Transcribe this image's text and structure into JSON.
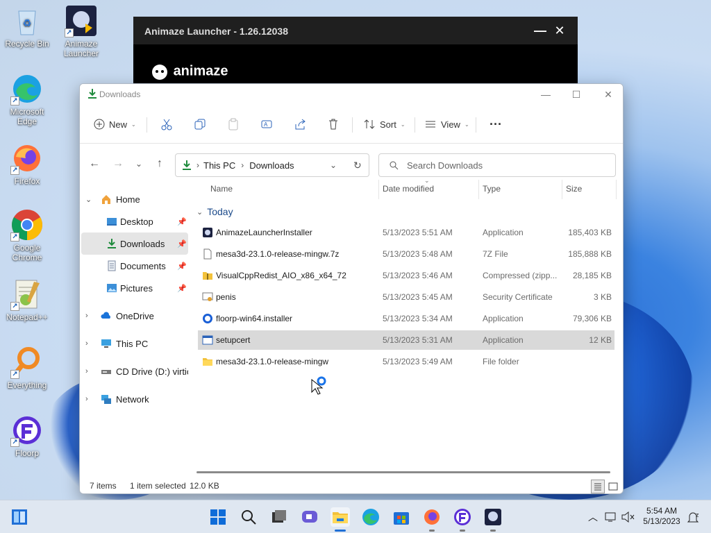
{
  "desktop": {
    "icons": [
      {
        "label": "Recycle Bin",
        "icon": "recycle-bin-icon"
      },
      {
        "label": "Animaze Launcher",
        "icon": "animaze-icon"
      },
      {
        "label": "Microsoft Edge",
        "icon": "edge-icon"
      },
      {
        "label": "Firefox",
        "icon": "firefox-icon"
      },
      {
        "label": "Google Chrome",
        "icon": "chrome-icon"
      },
      {
        "label": "Notepad++",
        "icon": "notepadpp-icon"
      },
      {
        "label": "Everything",
        "icon": "everything-icon"
      },
      {
        "label": "Floorp",
        "icon": "floorp-icon"
      }
    ]
  },
  "animaze": {
    "title": "Animaze Launcher - 1.26.12038",
    "logo_text": "animaze"
  },
  "explorer": {
    "title": "Downloads",
    "toolbar": {
      "new_label": "New",
      "sort_label": "Sort",
      "view_label": "View",
      "more_label": "···"
    },
    "address": {
      "crumbs": [
        "This PC",
        "Downloads"
      ]
    },
    "search": {
      "placeholder": "Search Downloads"
    },
    "sidebar": {
      "items": [
        {
          "label": "Home"
        },
        {
          "label": "Desktop"
        },
        {
          "label": "Downloads"
        },
        {
          "label": "Documents"
        },
        {
          "label": "Pictures"
        },
        {
          "label": "OneDrive"
        },
        {
          "label": "This PC"
        },
        {
          "label": "CD Drive (D:) virtio-w"
        },
        {
          "label": "Network"
        }
      ]
    },
    "columns": {
      "name": "Name",
      "date": "Date modified",
      "type": "Type",
      "size": "Size"
    },
    "group": "Today",
    "files": [
      {
        "name": "AnimazeLauncherInstaller",
        "date": "5/13/2023 5:51 AM",
        "type": "Application",
        "size": "185,403 KB",
        "icon": "app-icon"
      },
      {
        "name": "mesa3d-23.1.0-release-mingw.7z",
        "date": "5/13/2023 5:48 AM",
        "type": "7Z File",
        "size": "185,888 KB",
        "icon": "file-icon"
      },
      {
        "name": "VisualCppRedist_AIO_x86_x64_72",
        "date": "5/13/2023 5:46 AM",
        "type": "Compressed (zipp...",
        "size": "28,185 KB",
        "icon": "zip-folder-icon"
      },
      {
        "name": "penis",
        "date": "5/13/2023 5:45 AM",
        "type": "Security Certificate",
        "size": "3 KB",
        "icon": "certificate-icon"
      },
      {
        "name": "floorp-win64.installer",
        "date": "5/13/2023 5:34 AM",
        "type": "Application",
        "size": "79,306 KB",
        "icon": "installer-icon"
      },
      {
        "name": "setupcert",
        "date": "5/13/2023 5:31 AM",
        "type": "Application",
        "size": "12 KB",
        "icon": "app-window-icon"
      },
      {
        "name": "mesa3d-23.1.0-release-mingw",
        "date": "5/13/2023 5:49 AM",
        "type": "File folder",
        "size": "",
        "icon": "folder-icon"
      }
    ],
    "status": {
      "count": "7 items",
      "selected": "1 item selected",
      "size": "12.0 KB"
    }
  },
  "taskbar": {
    "time": "5:54 AM",
    "date": "5/13/2023"
  }
}
